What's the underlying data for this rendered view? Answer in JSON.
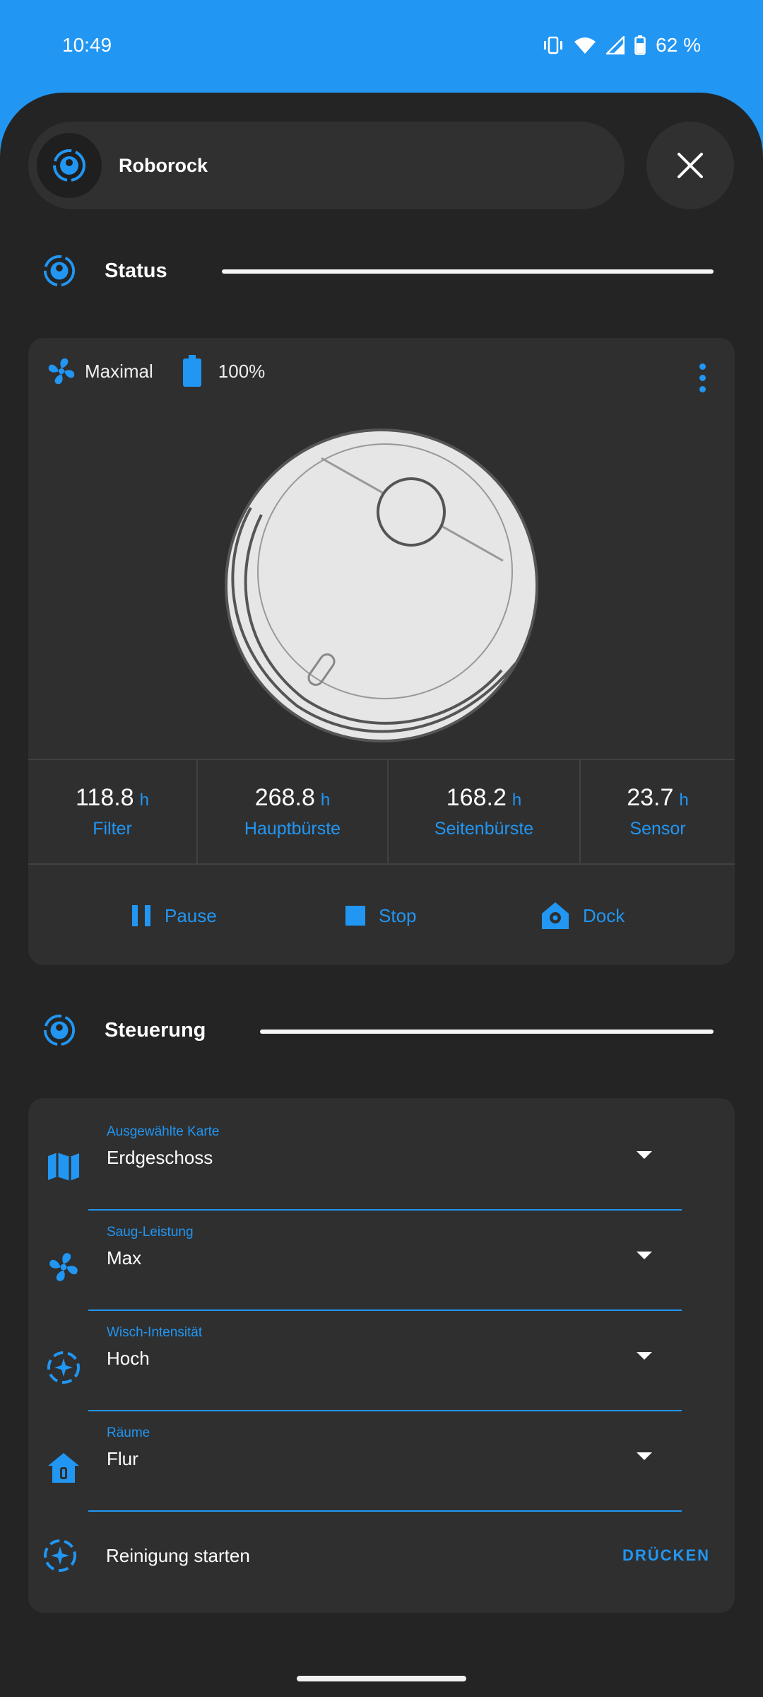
{
  "status_bar": {
    "time": "10:49",
    "battery": "62 %"
  },
  "header": {
    "title": "Roborock",
    "close_icon": "close-icon",
    "entity_icon": "robot-vacuum-icon"
  },
  "sections": {
    "status_title": "Status",
    "control_title": "Steuerung"
  },
  "status_card": {
    "fan_label": "Maximal",
    "battery_label": "100%",
    "stats": [
      {
        "value": "118.8",
        "unit": "h",
        "name": "Filter"
      },
      {
        "value": "268.8",
        "unit": "h",
        "name": "Hauptbürste"
      },
      {
        "value": "168.2",
        "unit": "h",
        "name": "Seitenbürste"
      },
      {
        "value": "23.7",
        "unit": "h",
        "name": "Sensor"
      }
    ],
    "actions": [
      {
        "label": "Pause",
        "icon": "pause-icon"
      },
      {
        "label": "Stop",
        "icon": "stop-icon"
      },
      {
        "label": "Dock",
        "icon": "home-map-marker-icon"
      }
    ]
  },
  "controls": {
    "fields": [
      {
        "label": "Ausgewählte Karte",
        "value": "Erdgeschoss",
        "icon": "map-icon"
      },
      {
        "label": "Saug-Leistung",
        "value": "Max",
        "icon": "fan-icon"
      },
      {
        "label": "Wisch-Intensität",
        "value": "Hoch",
        "icon": "robot-vacuum-sparkle-icon"
      },
      {
        "label": "Räume",
        "value": "Flur",
        "icon": "home-door-icon"
      }
    ],
    "run": {
      "label": "Reinigung starten",
      "button": "DRÜCKEN"
    }
  },
  "colors": {
    "accent": "#2196f3",
    "background": "#242424",
    "card": "#2f2f2f"
  }
}
